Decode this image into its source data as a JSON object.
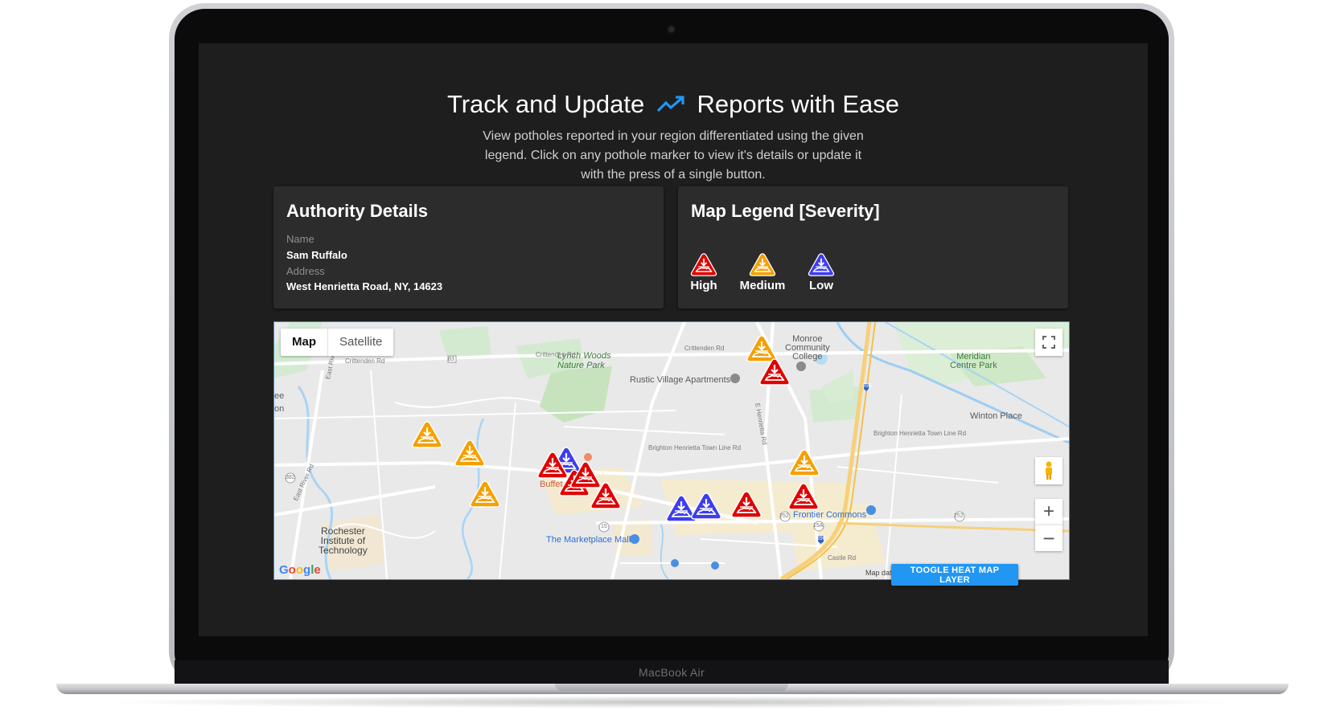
{
  "device": {
    "label": "MacBook Air"
  },
  "hero": {
    "title_part1": "Track and Update",
    "title_part2": "Reports with Ease",
    "subtitle": "View potholes reported in your region differentiated using the given legend. Click on any pothole marker to view it's details or update it with the press of a single button.",
    "icon": "trending-up-icon",
    "icon_color": "#2196f3"
  },
  "authority": {
    "title": "Authority Details",
    "name_label": "Name",
    "name_value": "Sam Ruffalo",
    "address_label": "Address",
    "address_value": "West Henrietta Road, NY, 14623"
  },
  "legend": {
    "title": "Map Legend [Severity]",
    "items": [
      {
        "label": "High",
        "color": "#e00000"
      },
      {
        "label": "Medium",
        "color": "#f5a000"
      },
      {
        "label": "Low",
        "color": "#3d3df0"
      }
    ]
  },
  "map": {
    "type_map": "Map",
    "type_satellite": "Satellite",
    "zoom_in": "+",
    "zoom_out": "−",
    "attribution": "Map data ©2020",
    "provider": "Google",
    "labels": {
      "lynch_woods": "Lynch Woods\nNature Park",
      "rustic_village": "Rustic Village Apartments",
      "monroe_cc": "Monroe\nCommunity\nCollege",
      "meridian": "Meridian\nCentre Park",
      "winton": "Winton Place",
      "frontier": "Frontier Commons",
      "marketplace": "The Marketplace Mall",
      "rit": "Rochester\nInstitute of\nTechnology",
      "buffet": "Buffet",
      "crittenden1": "Crittenden Rd",
      "crittenden2": "Crittenden Rd",
      "crittenden3": "Crittenden Rd",
      "brighton1": "Brighton Henrietta Town Line Rd",
      "brighton2": "Brighton Henrietta Town Line Rd",
      "east_river1": "East River Rd",
      "east_river2": "East River Rd",
      "e_henrietta": "E Henrietta Rd",
      "castle": "Castle Rd",
      "rte_83": "83",
      "rte_390a": "390",
      "rte_390b": "390",
      "rte_382": "382",
      "rte_252": "252",
      "rte_15a": "15A",
      "rte_252b": "252",
      "rte_15": "15",
      "edge_ee": "ee",
      "edge_on": "on"
    },
    "markers_note": "severity markers",
    "markers": [
      {
        "severity": "Medium"
      },
      {
        "severity": "High"
      },
      {
        "severity": "Medium"
      },
      {
        "severity": "Medium"
      },
      {
        "severity": "Medium"
      },
      {
        "severity": "Low"
      },
      {
        "severity": "High"
      },
      {
        "severity": "High"
      },
      {
        "severity": "High"
      },
      {
        "severity": "High"
      },
      {
        "severity": "Low"
      },
      {
        "severity": "Low"
      },
      {
        "severity": "High"
      },
      {
        "severity": "Medium"
      },
      {
        "severity": "High"
      }
    ]
  },
  "actions": {
    "heat_map_button": "TOOGLE HEAT MAP LAYER"
  }
}
